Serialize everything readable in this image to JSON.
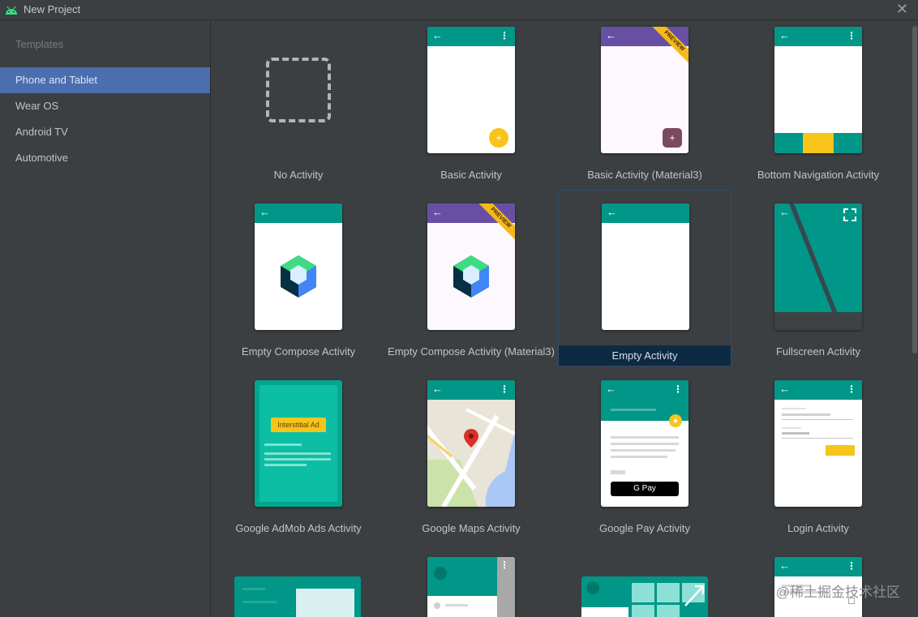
{
  "window": {
    "title": "New Project",
    "close": "✕"
  },
  "sidebar": {
    "heading": "Templates",
    "items": [
      {
        "label": "Phone and Tablet",
        "selected": true
      },
      {
        "label": "Wear OS",
        "selected": false
      },
      {
        "label": "Android TV",
        "selected": false
      },
      {
        "label": "Automotive",
        "selected": false
      }
    ]
  },
  "templates": [
    {
      "label": "No Activity"
    },
    {
      "label": "Basic Activity"
    },
    {
      "label": "Basic Activity (Material3)",
      "badge": "PREVIEW"
    },
    {
      "label": "Bottom Navigation Activity"
    },
    {
      "label": "Empty Compose Activity"
    },
    {
      "label": "Empty Compose Activity (Material3)",
      "badge": "PREVIEW"
    },
    {
      "label": "Empty Activity",
      "selected": true
    },
    {
      "label": "Fullscreen Activity"
    },
    {
      "label": "Google AdMob Ads Activity",
      "ad_button": "Interstitial Ad"
    },
    {
      "label": "Google Maps Activity"
    },
    {
      "label": "Google Pay Activity",
      "pay_button": "G Pay"
    },
    {
      "label": "Login Activity"
    }
  ],
  "icons": {
    "back": "←",
    "menu": "⋮",
    "fab": "+"
  },
  "colors": {
    "accent": "#009688",
    "selection": "#4b6eaf",
    "material3": "#6750a4",
    "fab": "#f7c41a"
  },
  "watermark": "@稀土掘金技术社区"
}
